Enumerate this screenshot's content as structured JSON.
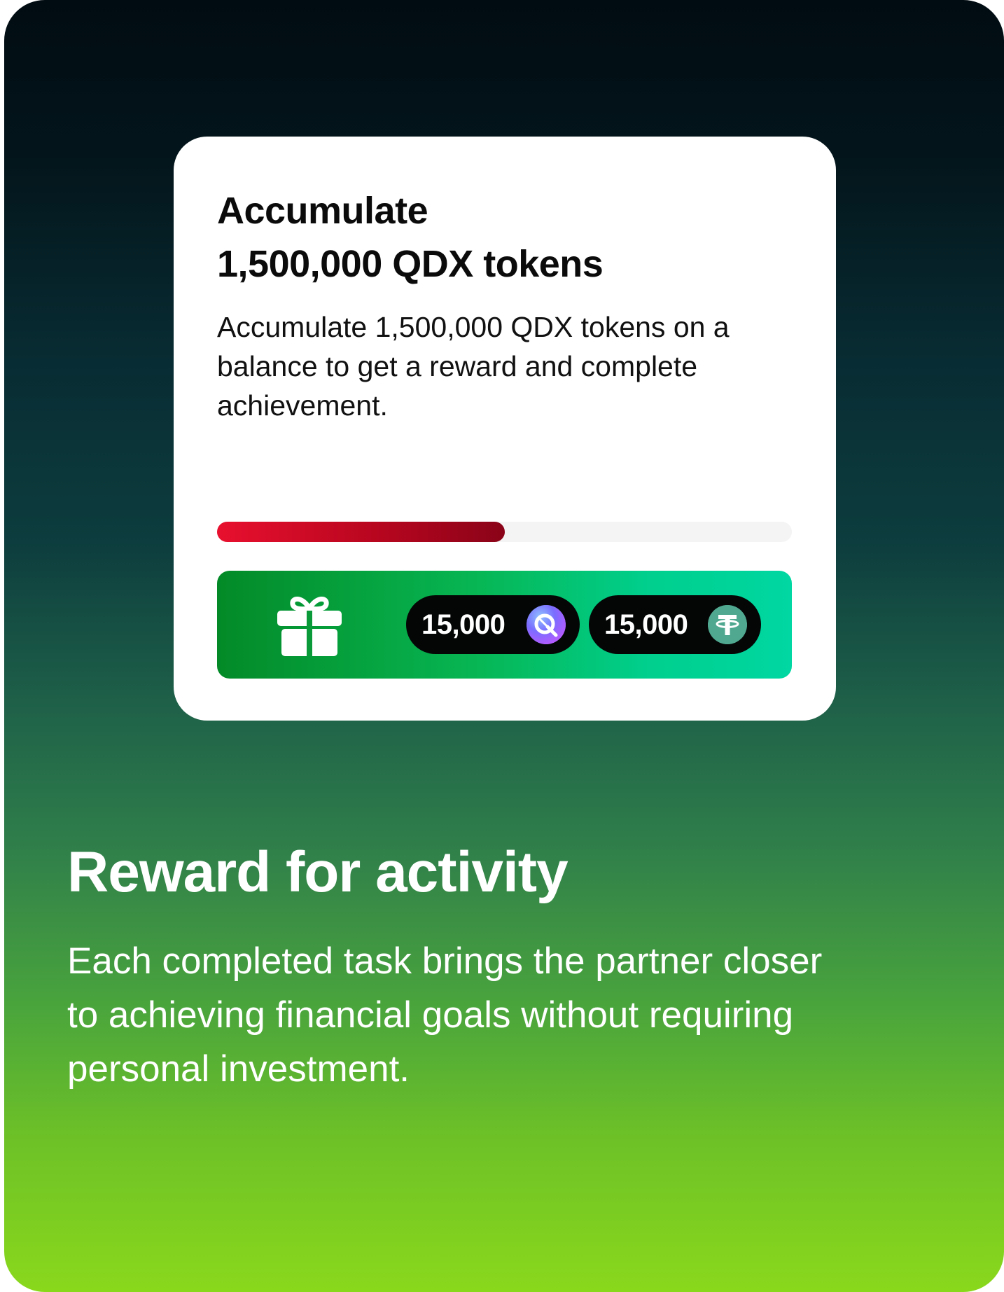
{
  "colors": {
    "background_top": "#010c12",
    "background_bottom": "#8ad81c",
    "card_background": "#ffffff",
    "progress_fill_start": "#e8102e",
    "progress_fill_end": "#8a0318",
    "reward_bar_start": "#038a27",
    "reward_bar_end": "#00d7a2",
    "chip_background": "#040606"
  },
  "task_card": {
    "title_lines": [
      "Accumulate",
      "1,500,000 QDX tokens"
    ],
    "description_lines": [
      "Accumulate 1,500,000 QDX tokens on a",
      "balance to get a reward and complete",
      "achievement."
    ],
    "progress_fraction": 0.5,
    "reward": {
      "icon": "gift-icon",
      "items": [
        {
          "amount": "15,000",
          "token_icon": "qdx-token-icon"
        },
        {
          "amount": "15,000",
          "token_icon": "usdt-token-icon"
        }
      ]
    }
  },
  "headline": "Reward for activity",
  "subtext_lines": [
    "Each completed task brings the partner closer",
    "to achieving financial goals without requiring",
    "personal investment."
  ]
}
